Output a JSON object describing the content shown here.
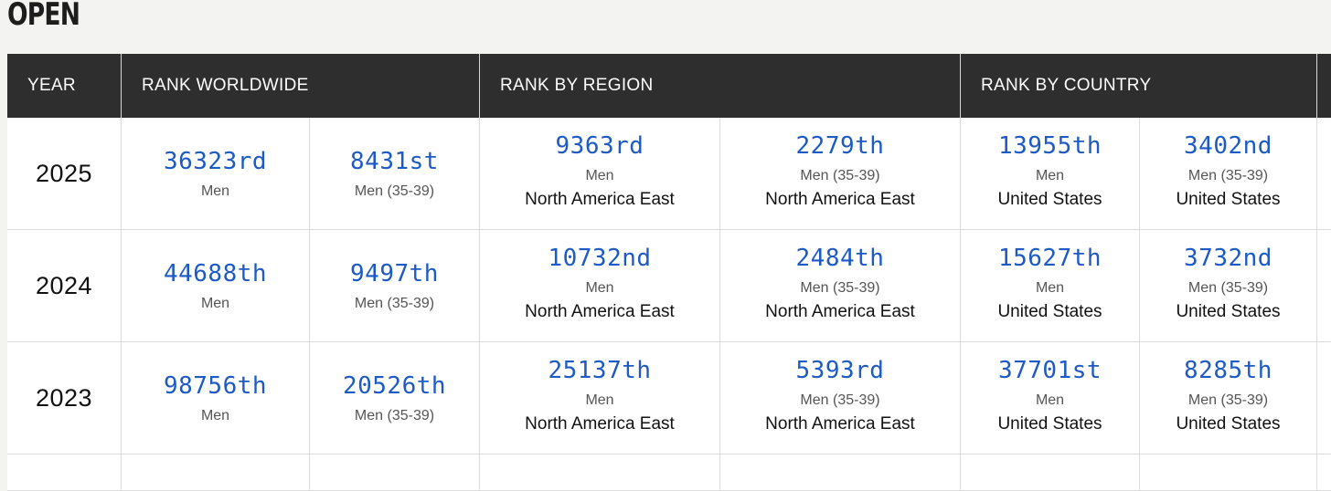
{
  "page_title": "OPEN",
  "headers": {
    "year": "YEAR",
    "worldwide": "RANK WORLDWIDE",
    "region": "RANK BY REGION",
    "country": "RANK BY COUNTRY"
  },
  "rows": [
    {
      "year": "2025",
      "worldwide": [
        {
          "rank": "36323rd",
          "cat": "Men"
        },
        {
          "rank": "8431st",
          "cat": "Men (35-39)"
        }
      ],
      "region": [
        {
          "rank": "9363rd",
          "cat": "Men",
          "loc": "North America East"
        },
        {
          "rank": "2279th",
          "cat": "Men (35-39)",
          "loc": "North America East"
        }
      ],
      "country": [
        {
          "rank": "13955th",
          "cat": "Men",
          "loc": "United States"
        },
        {
          "rank": "3402nd",
          "cat": "Men (35-39)",
          "loc": "United States"
        }
      ]
    },
    {
      "year": "2024",
      "worldwide": [
        {
          "rank": "44688th",
          "cat": "Men"
        },
        {
          "rank": "9497th",
          "cat": "Men (35-39)"
        }
      ],
      "region": [
        {
          "rank": "10732nd",
          "cat": "Men",
          "loc": "North America East"
        },
        {
          "rank": "2484th",
          "cat": "Men (35-39)",
          "loc": "North America East"
        }
      ],
      "country": [
        {
          "rank": "15627th",
          "cat": "Men",
          "loc": "United States"
        },
        {
          "rank": "3732nd",
          "cat": "Men (35-39)",
          "loc": "United States"
        }
      ]
    },
    {
      "year": "2023",
      "worldwide": [
        {
          "rank": "98756th",
          "cat": "Men"
        },
        {
          "rank": "20526th",
          "cat": "Men (35-39)"
        }
      ],
      "region": [
        {
          "rank": "25137th",
          "cat": "Men",
          "loc": "North America East"
        },
        {
          "rank": "5393rd",
          "cat": "Men (35-39)",
          "loc": "North America East"
        }
      ],
      "country": [
        {
          "rank": "37701st",
          "cat": "Men",
          "loc": "United States"
        },
        {
          "rank": "8285th",
          "cat": "Men (35-39)",
          "loc": "United States"
        }
      ]
    }
  ],
  "colors": {
    "header_bg": "#2e2e2e",
    "rank_link": "#1d5ac4",
    "page_bg": "#f3f3f1"
  }
}
